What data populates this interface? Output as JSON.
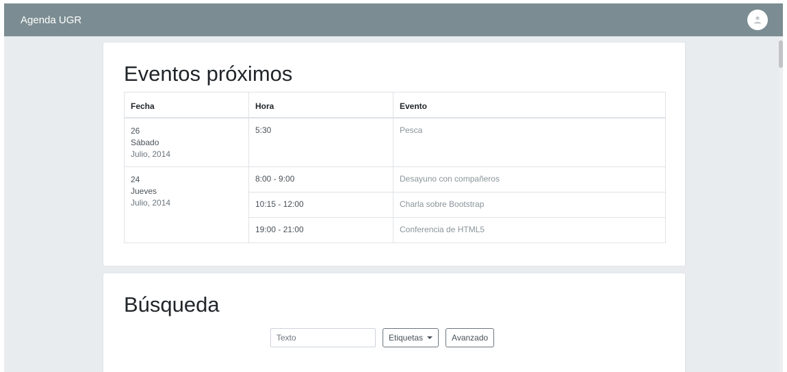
{
  "navbar": {
    "brand": "Agenda UGR",
    "avatar_icon": "user-avatar-icon"
  },
  "upcoming": {
    "title": "Eventos próximos",
    "columns": [
      "Fecha",
      "Hora",
      "Evento"
    ],
    "days": [
      {
        "day": "26",
        "weekday": "Sábado",
        "month": "Julio, 2014",
        "events": [
          {
            "time": "5:30",
            "name": "Pesca"
          }
        ]
      },
      {
        "day": "24",
        "weekday": "Jueves",
        "month": "Julio, 2014",
        "events": [
          {
            "time": "8:00 - 9:00",
            "name": "Desayuno con compañeros"
          },
          {
            "time": "10:15 - 12:00",
            "name": "Charla sobre Bootstrap"
          },
          {
            "time": "19:00 - 21:00",
            "name": "Conferencia de HTML5"
          }
        ]
      }
    ]
  },
  "search": {
    "title": "Búsqueda",
    "input_placeholder": "Texto",
    "tags_label": "Etiquetas",
    "advanced_label": "Avanzado"
  },
  "colors": {
    "navbar": "#7b8d92",
    "background": "#e9ecef",
    "event_link": "#8a9499"
  }
}
